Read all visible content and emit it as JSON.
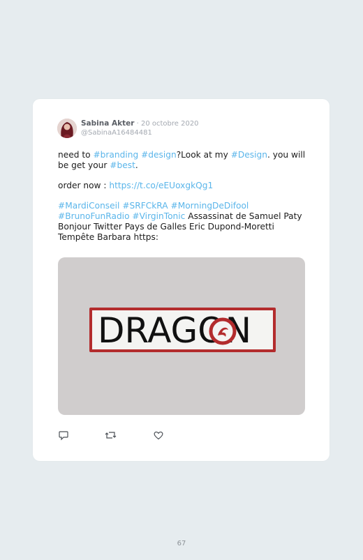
{
  "tweet": {
    "author_name": "Sabina Akter",
    "separator": " · ",
    "date": "20 octobre 2020",
    "handle": "@SabinaA16484481",
    "line1": [
      {
        "t": "need to ",
        "tag": false
      },
      {
        "t": "#branding",
        "tag": true
      },
      {
        "t": " ",
        "tag": false
      },
      {
        "t": "#design",
        "tag": true
      },
      {
        "t": "?Look at my ",
        "tag": false
      },
      {
        "t": "#Design",
        "tag": true
      },
      {
        "t": ". you will be get your ",
        "tag": false
      },
      {
        "t": "#best",
        "tag": true
      },
      {
        "t": ".",
        "tag": false
      }
    ],
    "line2": [
      {
        "t": "order now : ",
        "tag": false
      },
      {
        "t": "https://t.co/eEUoxgkQg1",
        "tag": true
      }
    ],
    "line3": [
      {
        "t": "#MardiConseil",
        "tag": true
      },
      {
        "t": " ",
        "tag": false
      },
      {
        "t": "#SRFCkRA",
        "tag": true
      },
      {
        "t": " ",
        "tag": false
      },
      {
        "t": "#MorningDeDifool",
        "tag": true
      },
      {
        "t": " ",
        "tag": false
      },
      {
        "t": "#BrunoFunRadio",
        "tag": true
      },
      {
        "t": " ",
        "tag": false
      },
      {
        "t": "#VirginTonic",
        "tag": true
      },
      {
        "t": " Assassinat de Samuel Paty Bonjour Twitter Pays de Galles Eric Dupond-Moretti Tempête Barbara https:",
        "tag": false
      }
    ],
    "media_logo_text": "DRAGON",
    "actions": [
      "reply-icon",
      "retweet-icon",
      "like-icon"
    ]
  },
  "colors": {
    "hashtag": "#5ab5ea",
    "logo_frame": "#b32c2d"
  },
  "footer": {
    "page_number": "67"
  }
}
